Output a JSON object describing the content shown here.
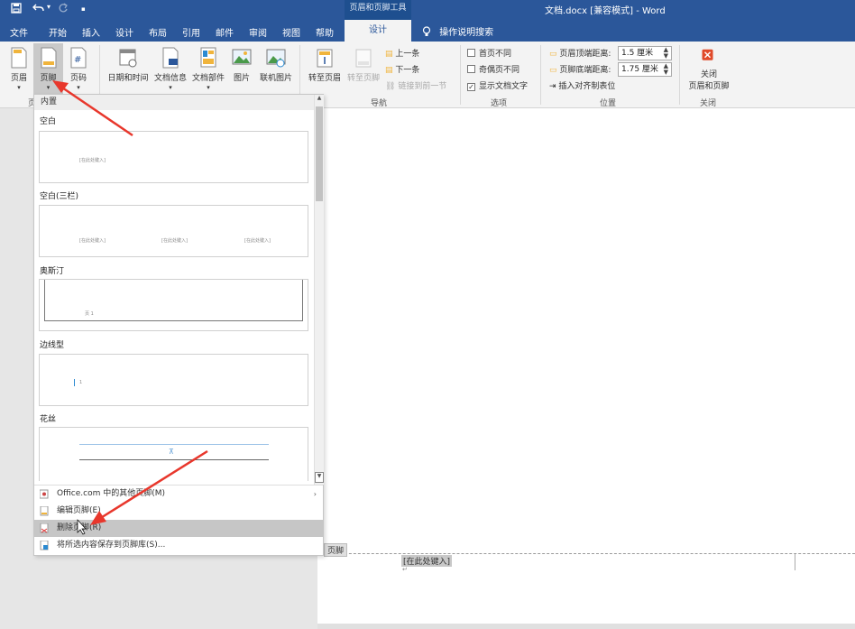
{
  "quick_access": {
    "save_icon": "save-icon",
    "undo_icon": "undo-icon",
    "redo_icon": "redo-icon",
    "customize": "▪"
  },
  "title_bar": {
    "contextual_tools": "页眉和页脚工具",
    "document_title": "文档.docx [兼容模式]  -  Word"
  },
  "tabs": [
    "文件",
    "开始",
    "插入",
    "设计",
    "布局",
    "引用",
    "邮件",
    "审阅",
    "视图",
    "帮助"
  ],
  "active_tab": "设计",
  "tell_me": "操作说明搜索",
  "ribbon": {
    "header_btn": "页眉",
    "footer_btn": "页脚",
    "pagenum_btn": "页码",
    "group1_label": "页",
    "date_btn": "日期和时间",
    "docinfo_btn": "文档信息",
    "parts_btn": "文档部件",
    "picture_btn": "图片",
    "online_btn": "联机图片",
    "goto_header": "转至页眉",
    "goto_footer": "转至页脚",
    "prev": "上一条",
    "next": "下一条",
    "link_prev": "链接到前一节",
    "nav_label": "导航",
    "opt_first": "首页不同",
    "opt_oddeven": "奇偶页不同",
    "opt_showtext": "显示文档文字",
    "options_label": "选项",
    "header_dist_label": "页眉顶端距离:",
    "header_dist_value": "1.5 厘米",
    "footer_dist_label": "页脚底端距离:",
    "footer_dist_value": "1.75 厘米",
    "insert_align_tab": "插入对齐制表位",
    "position_label": "位置",
    "close_btn_line1": "关闭",
    "close_btn_line2": "页眉和页脚",
    "close_label": "关闭"
  },
  "dropdown": {
    "section_header": "内置",
    "gallery": [
      {
        "title": "空白"
      },
      {
        "title": "空白(三栏)"
      },
      {
        "title": "奥斯汀"
      },
      {
        "title": "边线型"
      },
      {
        "title": "花丝"
      }
    ],
    "placeholder_text": "[在此处键入]",
    "austin_page": "页 1",
    "sideline_page": "1",
    "menu": [
      {
        "label": "Office.com 中的其他页脚(M)",
        "icon": "office-icon"
      },
      {
        "label": "编辑页脚(E)",
        "icon": "edit-footer-icon"
      },
      {
        "label": "删除页脚(R)",
        "icon": "delete-footer-icon"
      },
      {
        "label": "将所选内容保存到页脚库(S)...",
        "icon": "save-gallery-icon"
      }
    ]
  },
  "document": {
    "footer_tag": "页脚",
    "footer_placeholder": "[在此处键入]",
    "para_mark": "↵"
  },
  "colors": {
    "title_bar": "#2b579a",
    "arrow": "#e8372c",
    "close_icon": "#e04a2a"
  }
}
